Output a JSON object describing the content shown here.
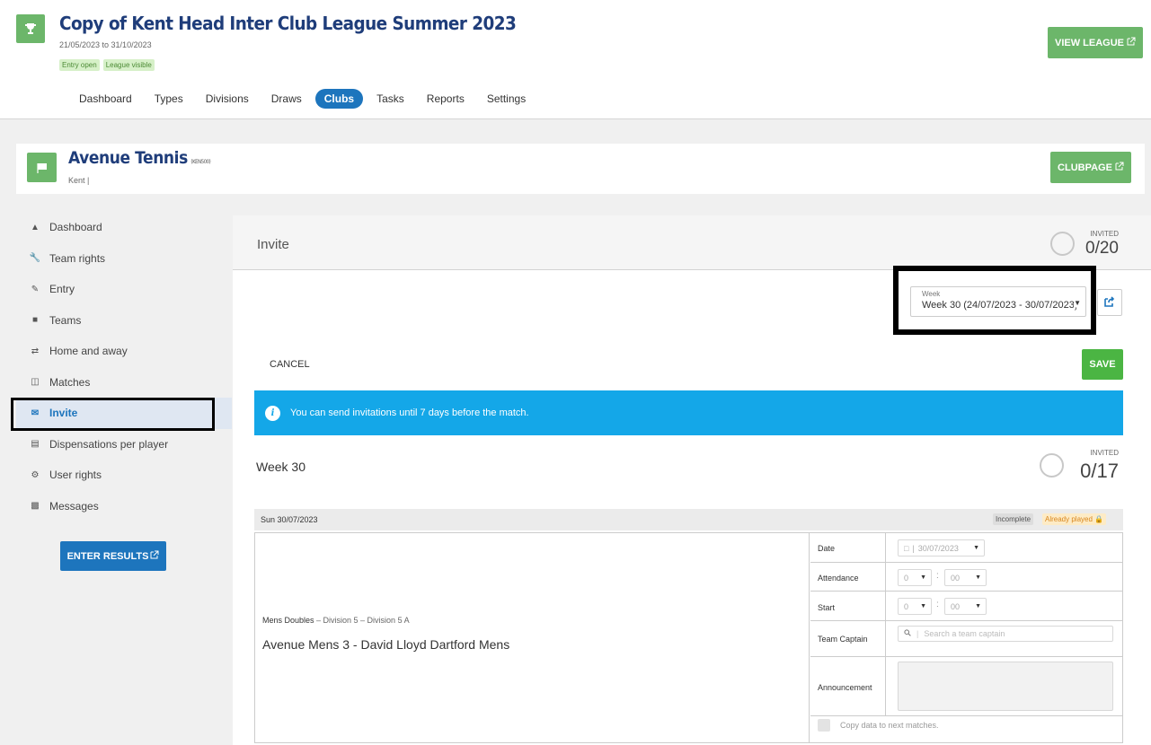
{
  "league": {
    "title": "Copy of Kent Head Inter Club League Summer 2023",
    "dates": "21/05/2023 to 31/10/2023",
    "badges": [
      "Entry open",
      "League visible"
    ],
    "view_button": "VIEW LEAGUE",
    "icon": "trophy-icon"
  },
  "nav": {
    "items": [
      "Dashboard",
      "Types",
      "Divisions",
      "Draws",
      "Clubs",
      "Tasks",
      "Reports",
      "Settings"
    ],
    "active": "Clubs"
  },
  "club": {
    "name": "Avenue Tennis",
    "code": "(KEN500)",
    "region": "Kent |",
    "clubpage_button": "CLUBPAGE",
    "icon": "flag-icon"
  },
  "sidebar": {
    "items": [
      {
        "label": "Dashboard",
        "icon": "home-icon"
      },
      {
        "label": "Team rights",
        "icon": "wrench-icon"
      },
      {
        "label": "Entry",
        "icon": "pencil-icon"
      },
      {
        "label": "Teams",
        "icon": "shirt-icon"
      },
      {
        "label": "Home and away",
        "icon": "swap-icon"
      },
      {
        "label": "Matches",
        "icon": "bracket-icon"
      },
      {
        "label": "Invite",
        "icon": "envelope-icon"
      },
      {
        "label": "Dispensations per player",
        "icon": "id-card-icon"
      },
      {
        "label": "User rights",
        "icon": "gear-icon"
      },
      {
        "label": "Messages",
        "icon": "chat-icon"
      }
    ],
    "active": "Invite",
    "enter_results": "ENTER RESULTS"
  },
  "invite": {
    "title": "Invite",
    "invited_label": "INVITED",
    "invited_total": "0/20",
    "week_select_label": "Week",
    "week_select_value": "Week 30 (24/07/2023 - 30/07/2023)",
    "cancel": "CANCEL",
    "save": "SAVE",
    "alert": "You can send invitations until 7 days before the match.",
    "week_heading": "Week 30",
    "week_invited_label": "INVITED",
    "week_invited": "0/17"
  },
  "match": {
    "date": "Sun 30/07/2023",
    "status_incomplete": "Incomplete",
    "status_played": "Already played",
    "type": "Mens Doubles",
    "division": " – Division 5 – Division 5 A",
    "teams": "Avenue Mens 3 - David Lloyd Dartford Mens",
    "form": {
      "date_label": "Date",
      "date_value": "30/07/2023",
      "attendance_label": "Attendance",
      "attendance_hour": "0",
      "attendance_min": "00",
      "start_label": "Start",
      "start_hour": "0",
      "start_min": "00",
      "captain_label": "Team Captain",
      "captain_placeholder": "Search a team captain",
      "announcement_label": "Announcement",
      "copy_label": "Copy data to next matches."
    }
  },
  "colors": {
    "primary_blue": "#1d75bd",
    "green": "#6cb66a",
    "save_green": "#4bb543",
    "info_blue": "#14a7e8",
    "title_navy": "#1f3d7a"
  }
}
